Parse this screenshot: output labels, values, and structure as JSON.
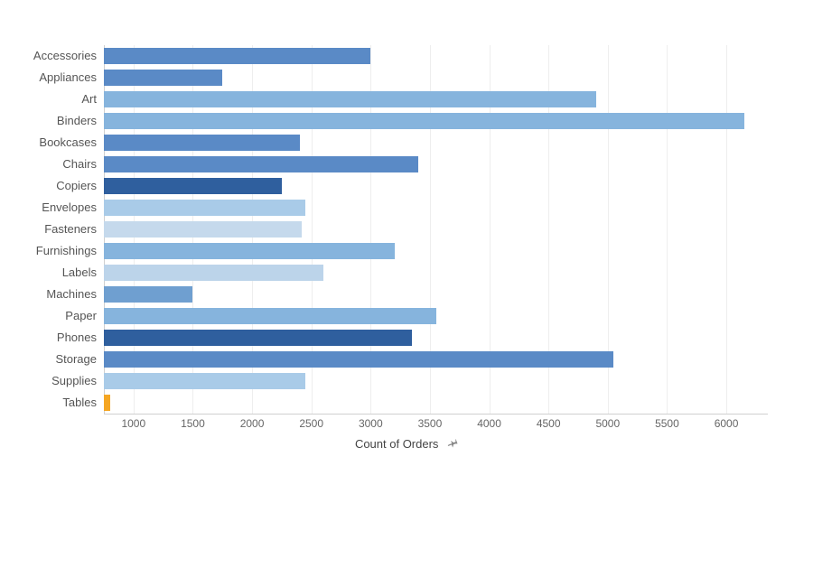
{
  "chart_data": {
    "type": "bar",
    "orientation": "horizontal",
    "xlabel": "Count of Orders",
    "ylabel": "",
    "xlim": [
      750,
      6350
    ],
    "x_ticks": [
      1000,
      1500,
      2000,
      2500,
      3000,
      3500,
      4000,
      4500,
      5000,
      5500,
      6000
    ],
    "categories": [
      "Accessories",
      "Appliances",
      "Art",
      "Binders",
      "Bookcases",
      "Chairs",
      "Copiers",
      "Envelopes",
      "Fasteners",
      "Furnishings",
      "Labels",
      "Machines",
      "Paper",
      "Phones",
      "Storage",
      "Supplies",
      "Tables"
    ],
    "values": [
      3000,
      1750,
      4900,
      6150,
      2400,
      3400,
      2250,
      2450,
      2420,
      3200,
      2600,
      1500,
      3550,
      3350,
      5050,
      2450,
      800
    ],
    "colors": [
      "#5a8ac6",
      "#5a8ac6",
      "#86b4dd",
      "#86b4dd",
      "#5a8ac6",
      "#5a8ac6",
      "#2f5f9e",
      "#a9cbe8",
      "#c5d9ec",
      "#86b4dd",
      "#bcd4ea",
      "#6f9fd0",
      "#86b4dd",
      "#2f5f9e",
      "#5a8ac6",
      "#a9cbe8",
      "#f5a623"
    ]
  },
  "axis": {
    "x_title": "Count of Orders",
    "pin_icon": "pin-icon"
  }
}
